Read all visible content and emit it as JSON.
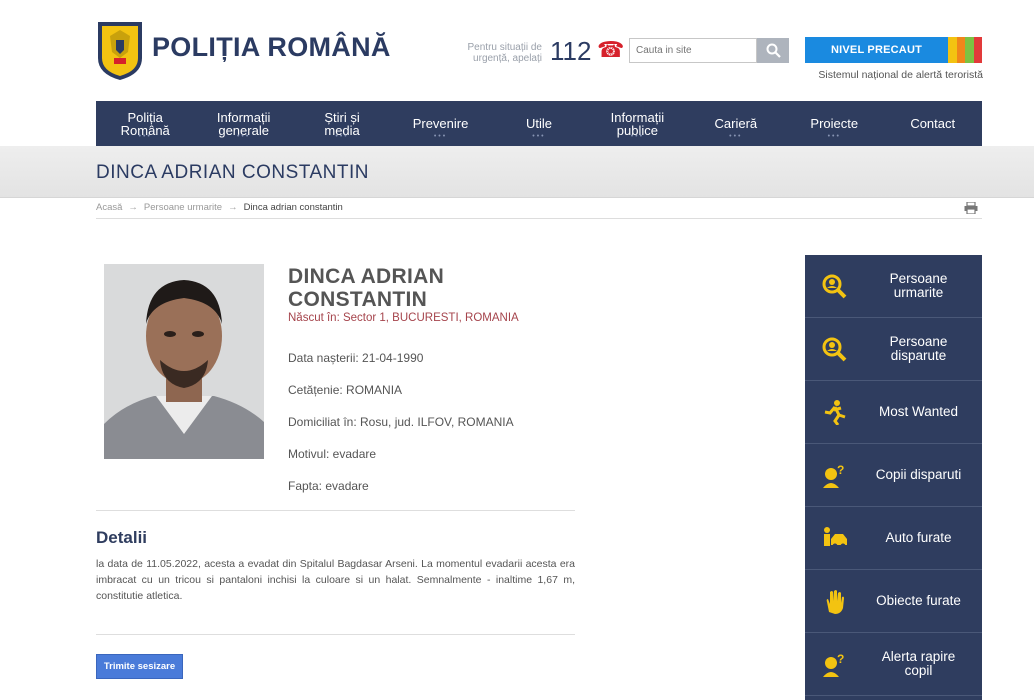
{
  "header": {
    "logo_title": "POLIȚIA ROMÂNĂ",
    "emergency_text_line1": "Pentru situații de",
    "emergency_text_line2": "urgență, apelați",
    "emergency_number": "112",
    "search_placeholder": "Cauta in site",
    "alert_button": "NIVEL PRECAUT",
    "alert_subtitle": "Sistemul național de alertă teroristă",
    "alert_colors": [
      "#3b8be0",
      "#f3c311",
      "#f0861a",
      "#7cc242",
      "#e23a3a"
    ]
  },
  "nav": {
    "items": [
      {
        "line1": "Poliția",
        "line2": "Română",
        "dots": "•••"
      },
      {
        "line1": "Informații",
        "line2": "generale",
        "dots": "•••"
      },
      {
        "line1": "Știri și",
        "line2": "media",
        "dots": "•••"
      },
      {
        "line1": "Prevenire",
        "line2": "",
        "dots": "•••"
      },
      {
        "line1": "Utile",
        "line2": "",
        "dots": "•••"
      },
      {
        "line1": "Informații",
        "line2": "publice",
        "dots": "•••"
      },
      {
        "line1": "Carieră",
        "line2": "",
        "dots": "•••"
      },
      {
        "line1": "Proiecte",
        "line2": "",
        "dots": "•••"
      },
      {
        "line1": "Contact",
        "line2": "",
        "dots": ""
      }
    ]
  },
  "page": {
    "title": "DINCA ADRIAN CONSTANTIN",
    "breadcrumb": [
      "Acasă",
      "Persoane urmarite",
      "Dinca adrian constantin"
    ],
    "breadcrumb_sep": "→"
  },
  "person": {
    "name_line1": "DINCA ADRIAN",
    "name_line2": "CONSTANTIN",
    "born": "Născut în: Sector 1, BUCURESTI, ROMANIA",
    "birth_date": "Data nașterii: 21-04-1990",
    "citizenship": "Cetățenie: ROMANIA",
    "domicile": "Domiciliat în: Rosu, jud. ILFOV, ROMANIA",
    "reason": "Motivul: evadare",
    "offense": "Fapta: evadare"
  },
  "details": {
    "heading": "Detalii",
    "text": "la data de 11.05.2022, acesta a evadat din Spitalul Bagdasar Arseni. La momentul evadarii acesta era imbracat cu un tricou si pantaloni inchisi la culoare si un halat. Semnalmente - inaltime 1,67 m, constitutie atletica.",
    "send_button": "Trimite sesizare"
  },
  "sidebar": {
    "items": [
      {
        "label_line1": "Persoane",
        "label_line2": "urmarite",
        "icon": "search-person-icon"
      },
      {
        "label_line1": "Persoane",
        "label_line2": "disparute",
        "icon": "search-person-icon"
      },
      {
        "label_line1": "Most Wanted",
        "label_line2": "",
        "icon": "running-man-icon"
      },
      {
        "label_line1": "Copii disparuti",
        "label_line2": "",
        "icon": "child-question-icon"
      },
      {
        "label_line1": "Auto furate",
        "label_line2": "",
        "icon": "car-thief-icon"
      },
      {
        "label_line1": "Obiecte furate",
        "label_line2": "",
        "icon": "hand-icon"
      },
      {
        "label_line1": "Alerta rapire",
        "label_line2": "copil",
        "icon": "child-question-icon"
      }
    ]
  }
}
